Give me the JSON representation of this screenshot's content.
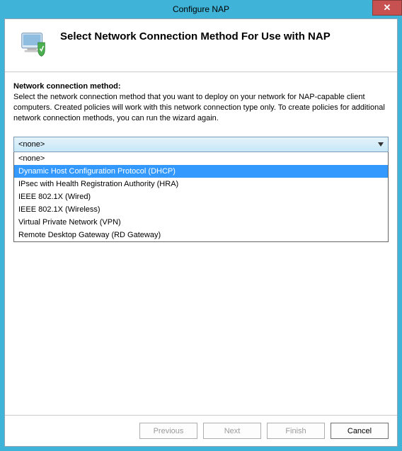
{
  "window": {
    "title": "Configure NAP",
    "close_label": "✕"
  },
  "header": {
    "title": "Select Network Connection Method For Use with NAP"
  },
  "section": {
    "label": "Network connection method:",
    "description": "Select the network connection method that you want to deploy on your network for NAP-capable client computers. Created policies will work with this network connection type only. To create policies for additional network connection methods, you can run the wizard again."
  },
  "combo": {
    "selected": "<none>",
    "options": [
      {
        "label": "<none>",
        "highlighted": false
      },
      {
        "label": "Dynamic Host Configuration Protocol (DHCP)",
        "highlighted": true
      },
      {
        "label": "IPsec with Health Registration Authority (HRA)",
        "highlighted": false
      },
      {
        "label": "IEEE 802.1X (Wired)",
        "highlighted": false
      },
      {
        "label": "IEEE 802.1X (Wireless)",
        "highlighted": false
      },
      {
        "label": "Virtual Private Network (VPN)",
        "highlighted": false
      },
      {
        "label": "Remote Desktop Gateway (RD Gateway)",
        "highlighted": false
      }
    ]
  },
  "buttons": {
    "previous": "Previous",
    "next": "Next",
    "finish": "Finish",
    "cancel": "Cancel"
  }
}
